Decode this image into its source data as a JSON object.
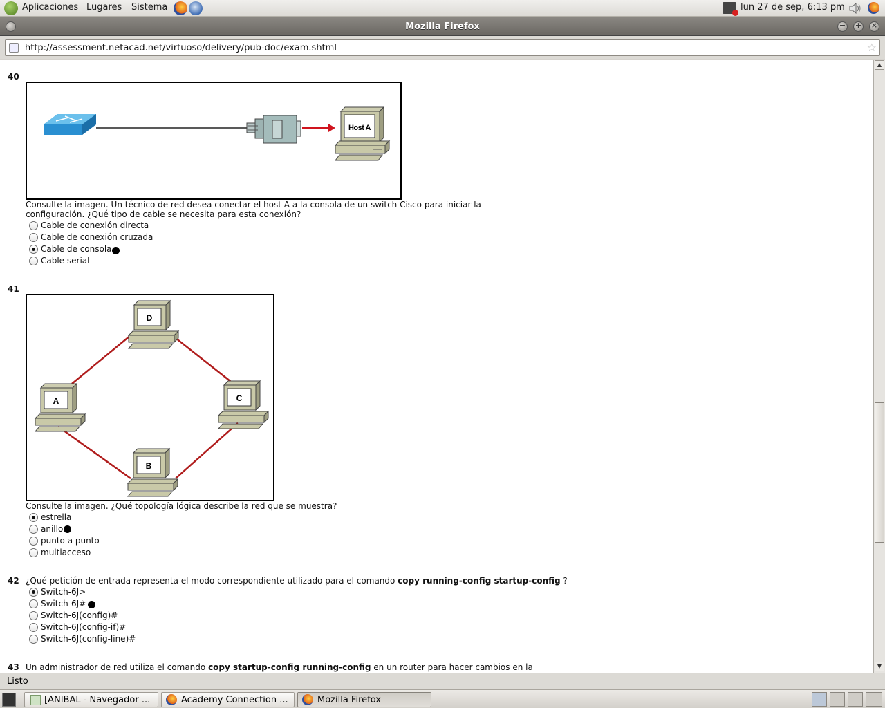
{
  "top_panel": {
    "menus": [
      "Aplicaciones",
      "Lugares",
      "Sistema"
    ],
    "clock": "lun 27 de sep,  6:13 pm"
  },
  "window": {
    "title": "Mozilla Firefox",
    "url": "http://assessment.netacad.net/virtuoso/delivery/pub-doc/exam.shtml",
    "status": "Listo"
  },
  "questions": [
    {
      "number": "40",
      "exhibit_labels": {
        "host": "Host A"
      },
      "text": "Consulte la imagen. Un técnico de red desea conectar el host A a la consola de un switch Cisco para iniciar la configuración. ¿Qué tipo de cable se necesita para esta conexión?",
      "options": [
        "Cable de conexión directa",
        "Cable de conexión cruzada",
        "Cable de consola",
        "Cable serial"
      ],
      "selected": 2,
      "marked": 2
    },
    {
      "number": "41",
      "exhibit_labels": {
        "d": "D",
        "a": "A",
        "c": "C",
        "b": "B"
      },
      "text": "Consulte la imagen. ¿Qué topología lógica describe la red que se muestra?",
      "options": [
        "estrella",
        "anillo",
        "punto a punto",
        "multiacceso"
      ],
      "selected": 0,
      "marked": 1
    },
    {
      "number": "42",
      "text_pre": "¿Qué petición de entrada representa el modo correspondiente utilizado para el comando ",
      "text_bold": "copy running-config startup-config",
      "text_post": " ?",
      "options": [
        "Switch-6J>",
        "Switch-6J#",
        "Switch-6J(config)#",
        "Switch-6J(config-if)#",
        "Switch-6J(config-line)#"
      ],
      "selected": 0,
      "marked": 1
    },
    {
      "number": "43",
      "text_pre": "Un administrador de red utiliza el comando ",
      "text_bold": "copy startup-config running-config",
      "text_post": " en un router para hacer cambios en la"
    }
  ],
  "taskbar": {
    "tasks": [
      "[ANIBAL - Navegador ...",
      "Academy Connection ...",
      "Mozilla Firefox"
    ]
  }
}
